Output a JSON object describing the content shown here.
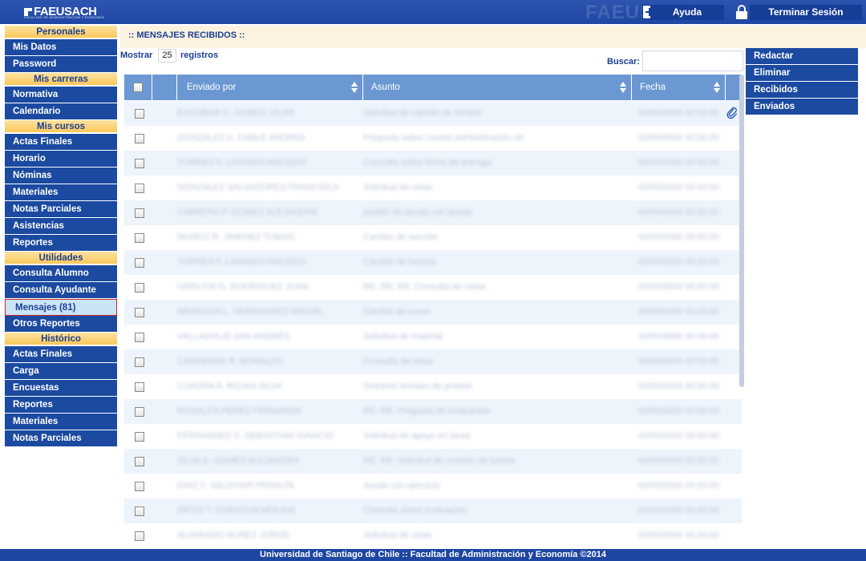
{
  "header": {
    "logo_text": "FAEUSACH",
    "logo_subtitle": "FACULTAD DE ADMINISTRACIÓN Y ECONOMÍA",
    "watermark": "FAEUSACH",
    "help_label": "Ayuda",
    "logout_label": "Terminar Sesión"
  },
  "sidebar": {
    "sections": [
      {
        "title": "Personales",
        "items": [
          "Mis Datos",
          "Password"
        ]
      },
      {
        "title": "Mis carreras",
        "items": [
          "Normativa",
          "Calendario"
        ]
      },
      {
        "title": "Mis cursos",
        "items": [
          "Actas Finales",
          "Horario",
          "Nóminas",
          "Materiales",
          "Notas Parciales",
          "Asistencias",
          "Reportes"
        ]
      },
      {
        "title": "Utilidades",
        "items": [
          "Consulta Alumno",
          "Consulta Ayudante",
          "Mensajes (81)",
          "Otros Reportes"
        ]
      },
      {
        "title": "Histórico",
        "items": [
          "Actas Finales",
          "Carga",
          "Encuestas",
          "Reportes",
          "Materiales",
          "Notas Parciales"
        ]
      }
    ],
    "active_item": "Mensajes (81)"
  },
  "main": {
    "title": ":: MENSAJES RECIBIDOS ::",
    "show_label": "Mostrar",
    "page_size": "25",
    "show_suffix": "registros",
    "search_label": "Buscar:",
    "search_value": "",
    "columns": [
      "Enviado por",
      "Asunto",
      "Fecha"
    ],
    "rows": [
      {
        "from": "ESCOBAR C. GOMEZ VILAR",
        "subject": "Solicitud de cambio de horario",
        "date": "00/00/0000 00:00:00"
      },
      {
        "from": "GÓNZALEZ A. CABLE ANDREA",
        "subject": "Pregunta sobre control administración de",
        "date": "00/00/0000 00:00:00"
      },
      {
        "from": "TORRES F. LAVANDA MACEDO",
        "subject": "Consulta sobre fecha de entrega",
        "date": "00/00/0000 00:00:00"
      },
      {
        "from": "GONZALEZ SALVADORES FRANCISCA",
        "subject": "Solicitud de notas",
        "date": "00/00/0000 00:00:00"
      },
      {
        "from": "CABRERA P. GOMEZ ALEJANDRA",
        "subject": "pedido de ayuda con tareas",
        "date": "00/00/0000 00:00:00"
      },
      {
        "from": "MUÑOZ R. JIMENEZ TOMAS",
        "subject": "Cambio de sección",
        "date": "00/00/0000 00:00:00"
      },
      {
        "from": "TORRES F. LAVANDA MACEDO",
        "subject": "Cambio de horario",
        "date": "00/00/0000 00:00:00"
      },
      {
        "from": "URRUTIA G. RODRIGUEZ JUAN",
        "subject": "RE: RE: RE: Consulta de notas",
        "date": "00/00/0000 00:00:00"
      },
      {
        "from": "MENDOZA L. HERNANDEZ MIGUEL",
        "subject": "Cambio de curso",
        "date": "00/00/0000 00:00:00"
      },
      {
        "from": "VALLADOLID SAN ANDRÉS",
        "subject": "Solicitud de material",
        "date": "00/00/0000 00:00:00"
      },
      {
        "from": "CÁRDENAS R. MORALES",
        "subject": "Consulta de tarea",
        "date": "00/00/0000 00:00:00"
      },
      {
        "from": "CUADRA A. ROJAS SILVA",
        "subject": "Solicitud revisión de prueba",
        "date": "00/00/0000 00:00:00"
      },
      {
        "from": "ROSALES PÉREZ FERNANDA",
        "subject": "RE: RE: Pregunta de evaluación",
        "date": "00/00/0000 00:00:00"
      },
      {
        "from": "FERNANDEZ S. SEBASTIAN IGNACIO",
        "subject": "Solicitud de apoyo en tarea",
        "date": "00/00/0000 00:00:00"
      },
      {
        "from": "SILVA A. GOMEZ ALEJANDRA",
        "subject": "RE: RE: Solicitud de reunión de tutoría",
        "date": "00/00/0000 00:00:00"
      },
      {
        "from": "DÍAZ Z. SALDIVAR PERALTA",
        "subject": "Ayuda con ejercicio",
        "date": "00/00/0000 00:00:00"
      },
      {
        "from": "ORTIZ T. CORDOVA MOLINA",
        "subject": "Consulta sobre evaluación",
        "date": "00/00/0000 00:00:00"
      },
      {
        "from": "ALVARADO NUÑEZ JORGE",
        "subject": "Solicitud de clase",
        "date": "00/00/0000 00:00:00"
      }
    ]
  },
  "right_menu": {
    "items": [
      "Redactar",
      "Eliminar",
      "Recibidos",
      "Enviados"
    ]
  },
  "footer": {
    "text": "Universidad de Santiago de Chile :: Facultad de Administración y Economía ©2014"
  }
}
